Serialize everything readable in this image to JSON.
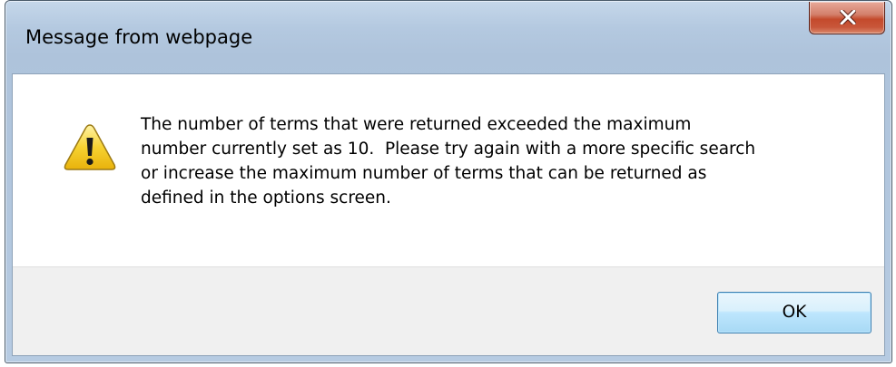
{
  "dialog": {
    "title": "Message from webpage",
    "message": "The number of terms that were returned exceeded the maximum\nnumber currently set as 10.  Please try again with a more specific search\nor increase the maximum number of terms that can be returned as\ndefined in the options screen.",
    "icon": "warning-icon",
    "ok_label": "OK",
    "close_icon": "close-icon"
  },
  "colors": {
    "title_frame": "#b4c9e0",
    "close_button": "#c44a2c",
    "button_area": "#f0f0f0",
    "ok_button": "#bee6fd",
    "warning_fill": "#f6d231"
  }
}
